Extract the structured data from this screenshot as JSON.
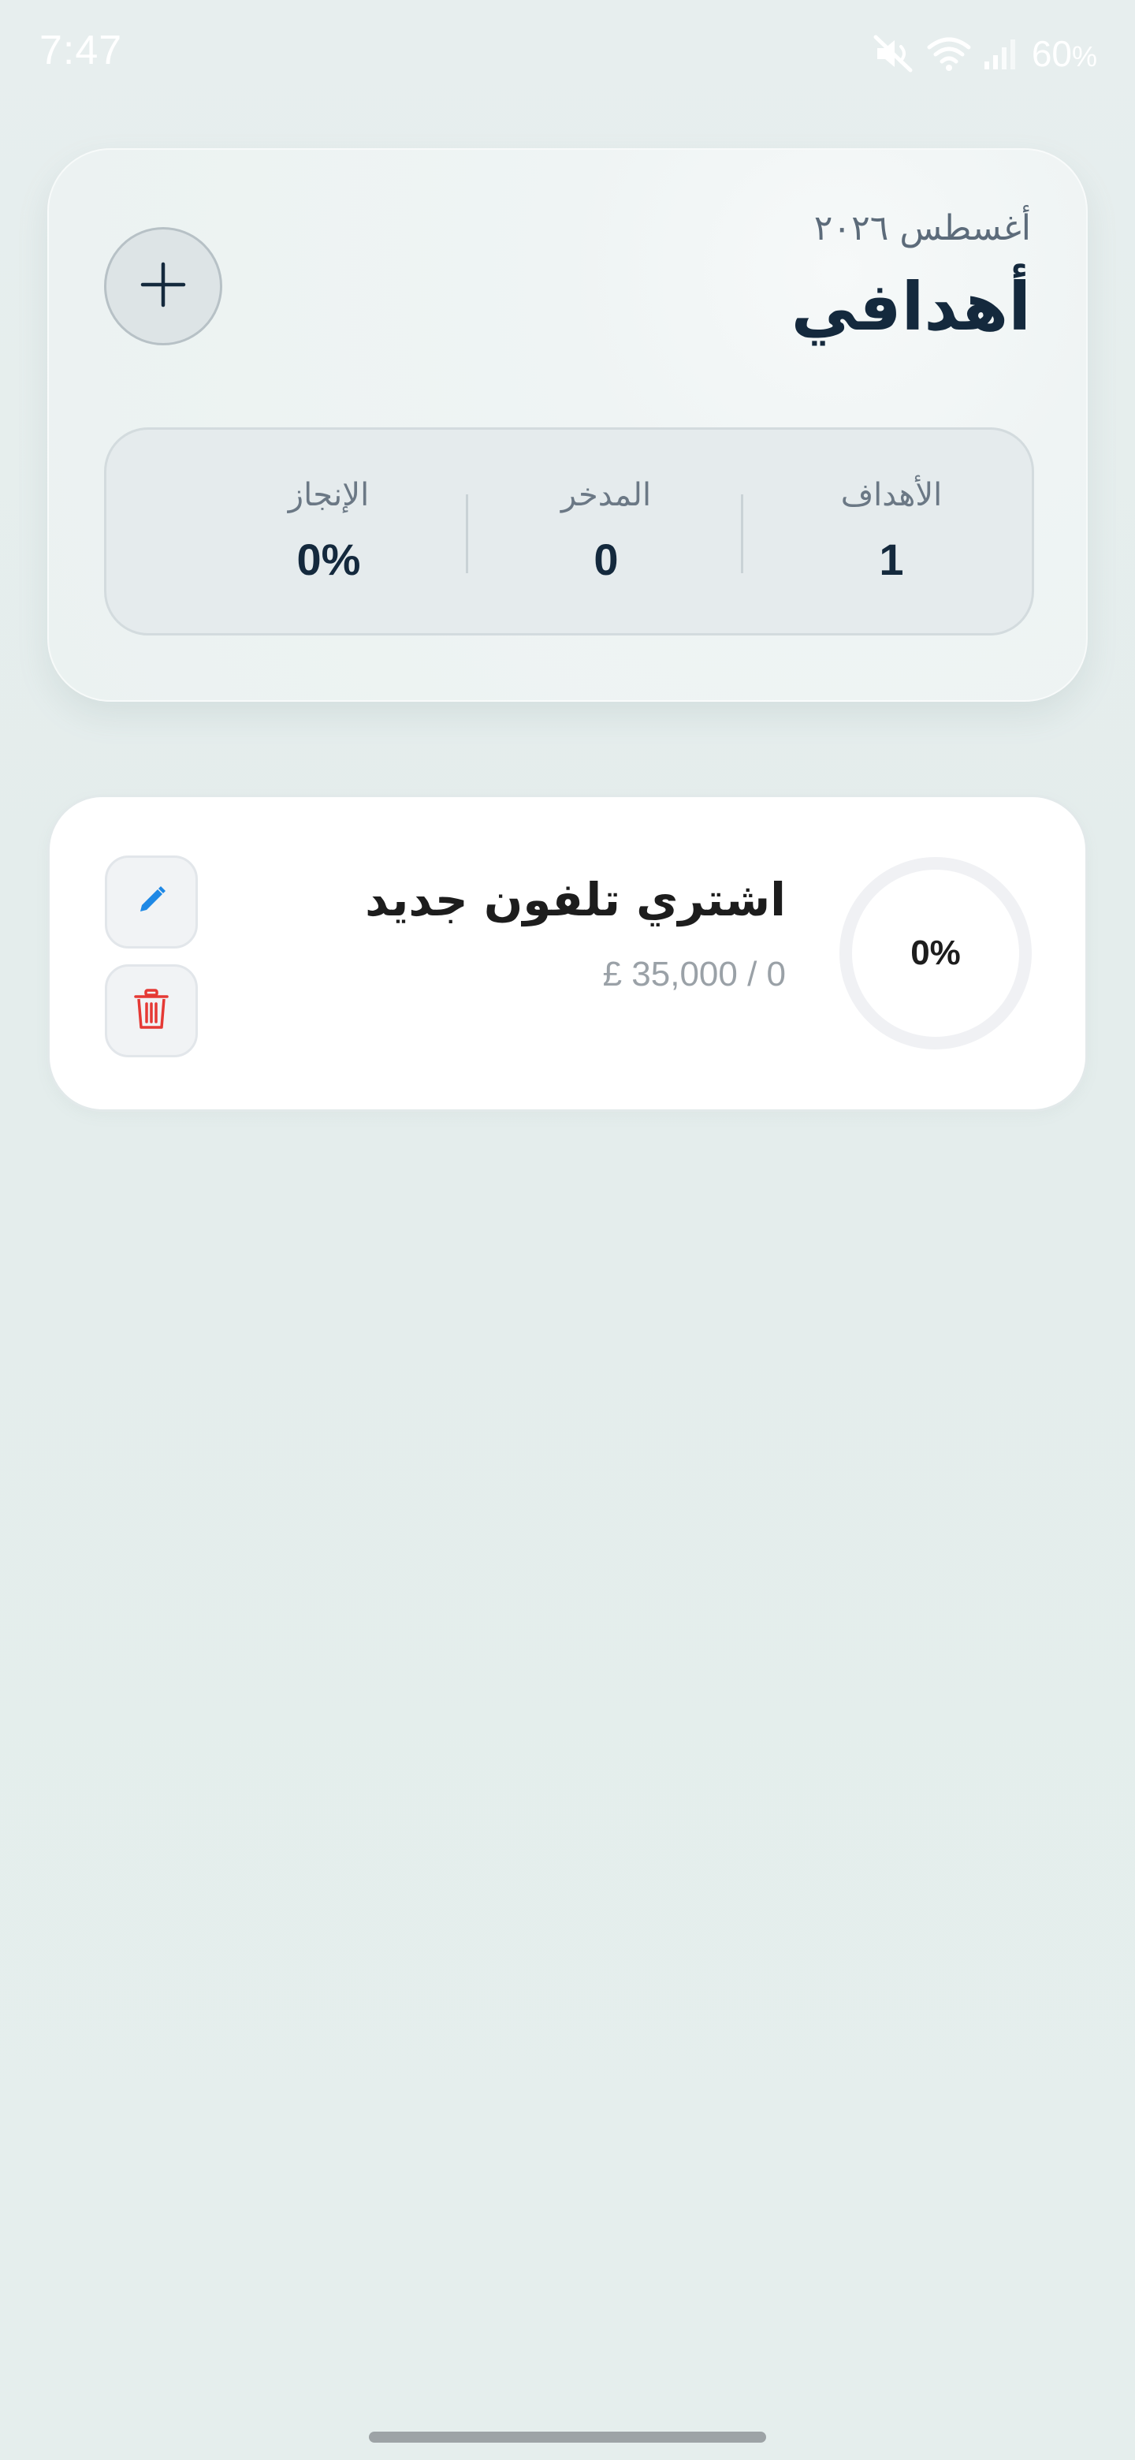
{
  "status_bar": {
    "time": "7:47",
    "battery_value": "60",
    "battery_unit": "%",
    "icons": [
      "mute-icon",
      "wifi-icon",
      "signal-icon"
    ]
  },
  "header": {
    "month": "أغسطس ٢٠٢٦",
    "title": "أهدافي",
    "add_icon": "plus-icon"
  },
  "stats": {
    "goals": {
      "label": "الأهداف",
      "value": "1"
    },
    "saved": {
      "label": "المدخر",
      "value": "0"
    },
    "achievement": {
      "label": "الإنجاز",
      "value": "0%"
    }
  },
  "goals": [
    {
      "name": "اشتري تلفون جديد",
      "amount": "£ 35,000 / 0",
      "progress_label": "0%",
      "progress": 0,
      "edit_icon": "pencil-icon",
      "delete_icon": "trash-icon"
    }
  ],
  "colors": {
    "background": "#e5eeed",
    "primary_text": "#14293d",
    "edit_accent": "#1e88e5",
    "delete_accent": "#e53935",
    "ring_track": "#f0f1f4"
  }
}
